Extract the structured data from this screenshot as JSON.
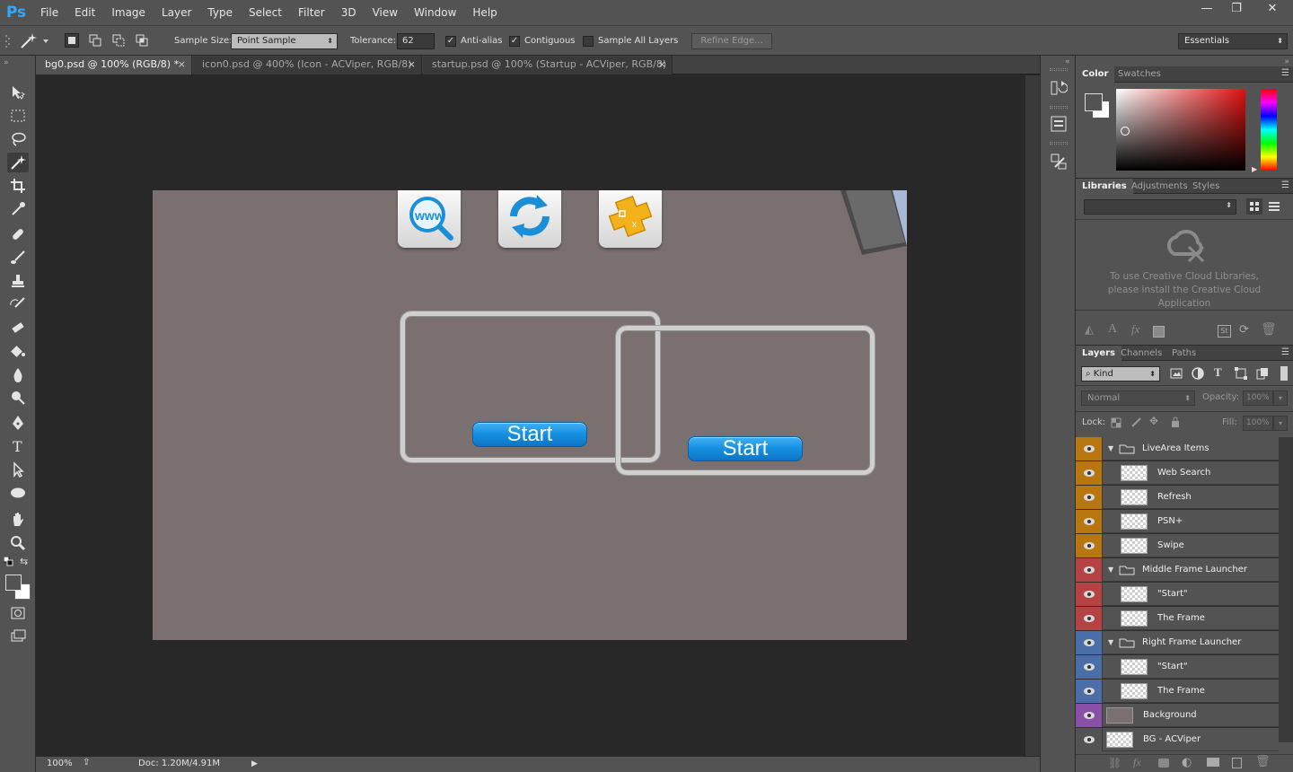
{
  "app": {
    "logo": "Ps"
  },
  "menu": [
    "File",
    "Edit",
    "Image",
    "Layer",
    "Type",
    "Select",
    "Filter",
    "3D",
    "View",
    "Window",
    "Help"
  ],
  "window_controls": {
    "minimize": "—",
    "restore": "❐",
    "close": "✕"
  },
  "options": {
    "sample_size_label": "Sample Size:",
    "sample_size_value": "Point Sample",
    "tolerance_label": "Tolerance:",
    "tolerance_value": "62",
    "anti_alias_label": "Anti-alias",
    "anti_alias_checked": true,
    "contiguous_label": "Contiguous",
    "contiguous_checked": true,
    "sample_all_label": "Sample All Layers",
    "sample_all_checked": false,
    "refine_edge_label": "Refine Edge...",
    "workspace_value": "Essentials"
  },
  "tabs": [
    {
      "label": "bg0.psd @ 100% (RGB/8) *",
      "active": true
    },
    {
      "label": "icon0.psd @ 400% (Icon - ACViper, RGB/8)",
      "active": false
    },
    {
      "label": "startup.psd @ 100% (Startup - ACViper, RGB/8)",
      "active": false
    }
  ],
  "canvas": {
    "background": "#7a706f",
    "start_label_1": "Start",
    "start_label_2": "Start"
  },
  "status": {
    "zoom": "100%",
    "doc": "Doc: 1.20M/4.91M"
  },
  "color_panel": {
    "tabs": [
      "Color",
      "Swatches"
    ]
  },
  "libraries_panel": {
    "tabs": [
      "Libraries",
      "Adjustments",
      "Styles"
    ],
    "message": "To use Creative Cloud Libraries, please install the Creative Cloud Application"
  },
  "layers_panel": {
    "tabs": [
      "Layers",
      "Channels",
      "Paths"
    ],
    "filter_value": "Kind",
    "blend_mode": "Normal",
    "opacity_label": "Opacity:",
    "opacity_value": "100%",
    "lock_label": "Lock:",
    "fill_label": "Fill:",
    "fill_value": "100%",
    "layers": [
      {
        "name": "LiveArea Items",
        "type": "group",
        "color": "#b8770e",
        "indent": 0
      },
      {
        "name": "Web Search",
        "type": "layer",
        "color": "#b8770e",
        "indent": 1
      },
      {
        "name": "Refresh",
        "type": "layer",
        "color": "#b8770e",
        "indent": 1
      },
      {
        "name": "PSN+",
        "type": "layer",
        "color": "#b8770e",
        "indent": 1
      },
      {
        "name": "Swipe",
        "type": "layer",
        "color": "#b8770e",
        "indent": 1
      },
      {
        "name": "Middle Frame Launcher",
        "type": "group",
        "color": "#b54343",
        "indent": 0
      },
      {
        "name": "\"Start\"",
        "type": "layer",
        "color": "#b54343",
        "indent": 1
      },
      {
        "name": "The Frame",
        "type": "layer",
        "color": "#b54343",
        "indent": 1
      },
      {
        "name": "Right Frame Launcher",
        "type": "group",
        "color": "#4a6fa8",
        "indent": 0
      },
      {
        "name": "\"Start\"",
        "type": "layer",
        "color": "#4a6fa8",
        "indent": 1
      },
      {
        "name": "The Frame",
        "type": "layer",
        "color": "#4a6fa8",
        "indent": 1
      },
      {
        "name": "Background",
        "type": "fill",
        "color": "#8a4fa6",
        "indent": 0
      },
      {
        "name": "BG - ACViper",
        "type": "layer",
        "color": "#535353",
        "indent": 0
      }
    ]
  }
}
